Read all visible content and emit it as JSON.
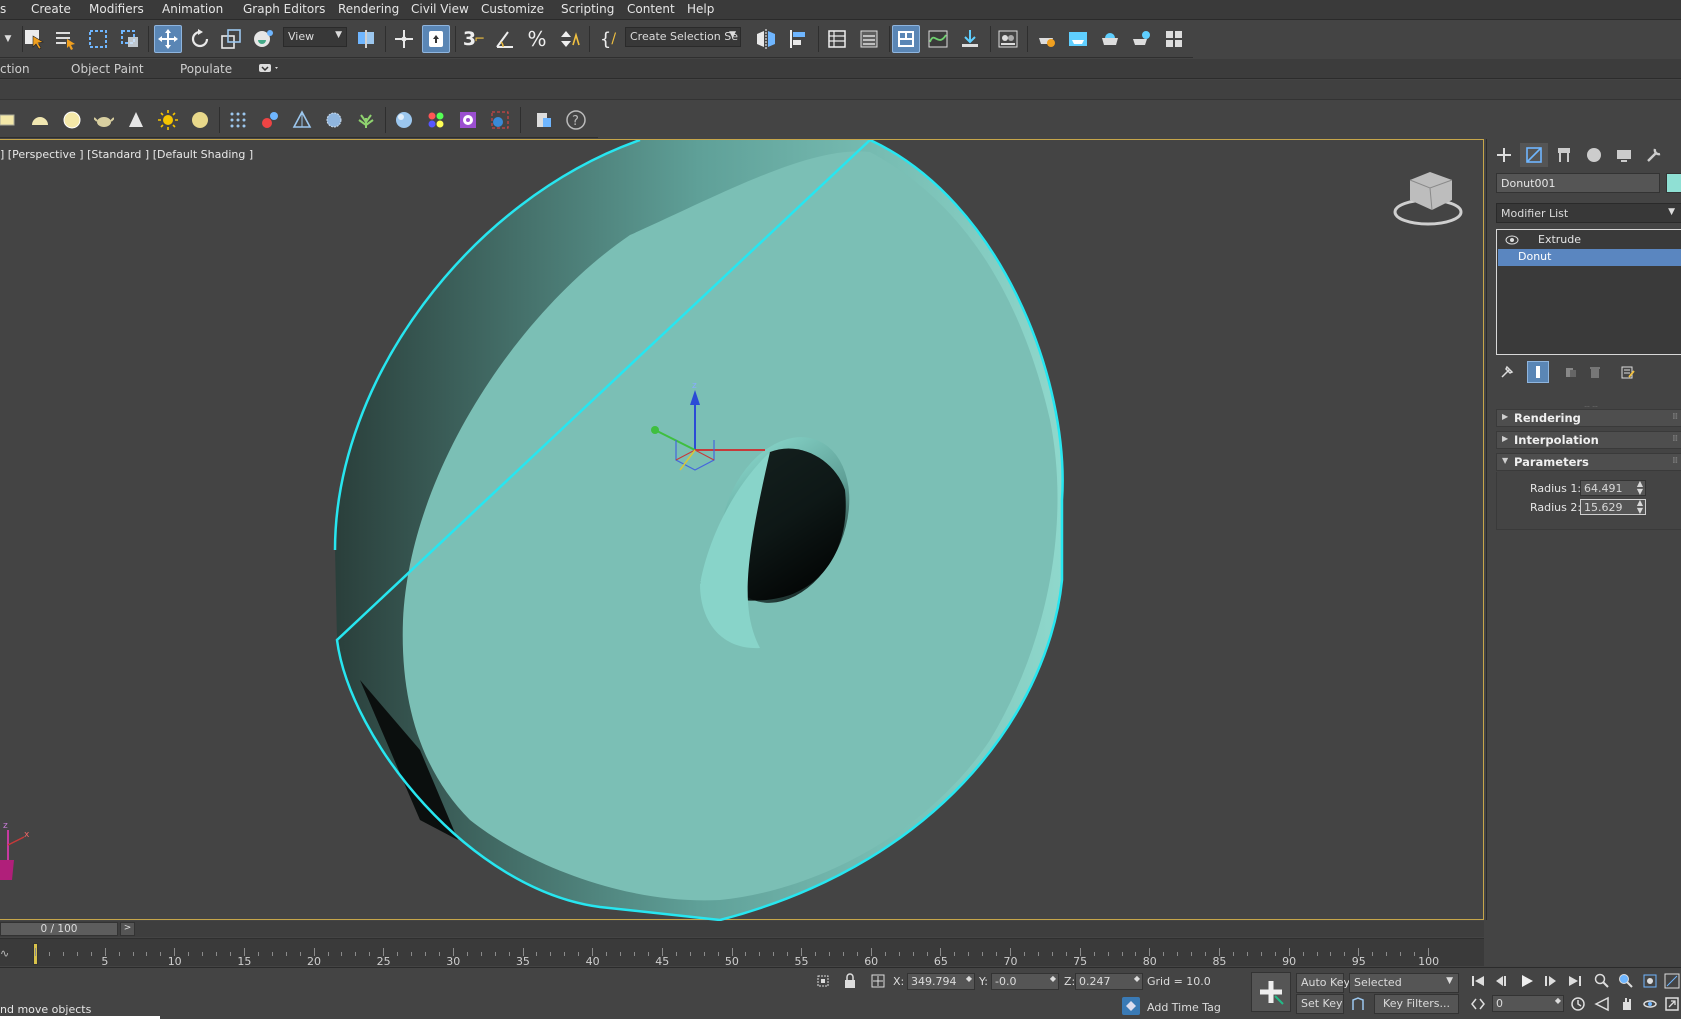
{
  "menu": [
    "s",
    "Create",
    "Modifiers",
    "Animation",
    "Graph Editors",
    "Rendering",
    "Civil View",
    "Customize",
    "Scripting",
    "Content",
    "Help"
  ],
  "toolbar": {
    "view_dropdown": "View",
    "selection_set": "Create Selection Se"
  },
  "ribbon": {
    "tabs": [
      "ction",
      "Object Paint",
      "Populate"
    ]
  },
  "viewport": {
    "label": "] [Perspective ] [Standard ] [Default Shading ]",
    "object_color": "#8fe0d4",
    "selection_color": "#27e6f0"
  },
  "command_panel": {
    "object_name": "Donut001",
    "modifier_list": "Modifier List",
    "stack": [
      "Extrude",
      "Donut"
    ],
    "rollouts": [
      "Rendering",
      "Interpolation",
      "Parameters"
    ],
    "params": {
      "radius1_label": "Radius 1:",
      "radius1_value": "64.491",
      "radius2_label": "Radius 2:",
      "radius2_value": "15.629"
    }
  },
  "timeline": {
    "frame": "0 / 100",
    "next": ">",
    "ticks": [
      "5",
      "10",
      "15",
      "20",
      "25",
      "30",
      "35",
      "40",
      "45",
      "50",
      "55",
      "60",
      "65",
      "70",
      "75",
      "80",
      "85",
      "90",
      "95",
      "100"
    ]
  },
  "status": {
    "prompt": "nd move objects",
    "x_label": "X:",
    "x_value": "349.794",
    "y_label": "Y:",
    "y_value": "-0.0",
    "z_label": "Z:",
    "z_value": "0.247",
    "grid": "Grid = 10.0",
    "add_time_tag": "Add Time Tag",
    "auto_key": "Auto Key",
    "set_key": "Set Key",
    "selected": "Selected",
    "key_filters": "Key Filters...",
    "frame_value": "0"
  }
}
